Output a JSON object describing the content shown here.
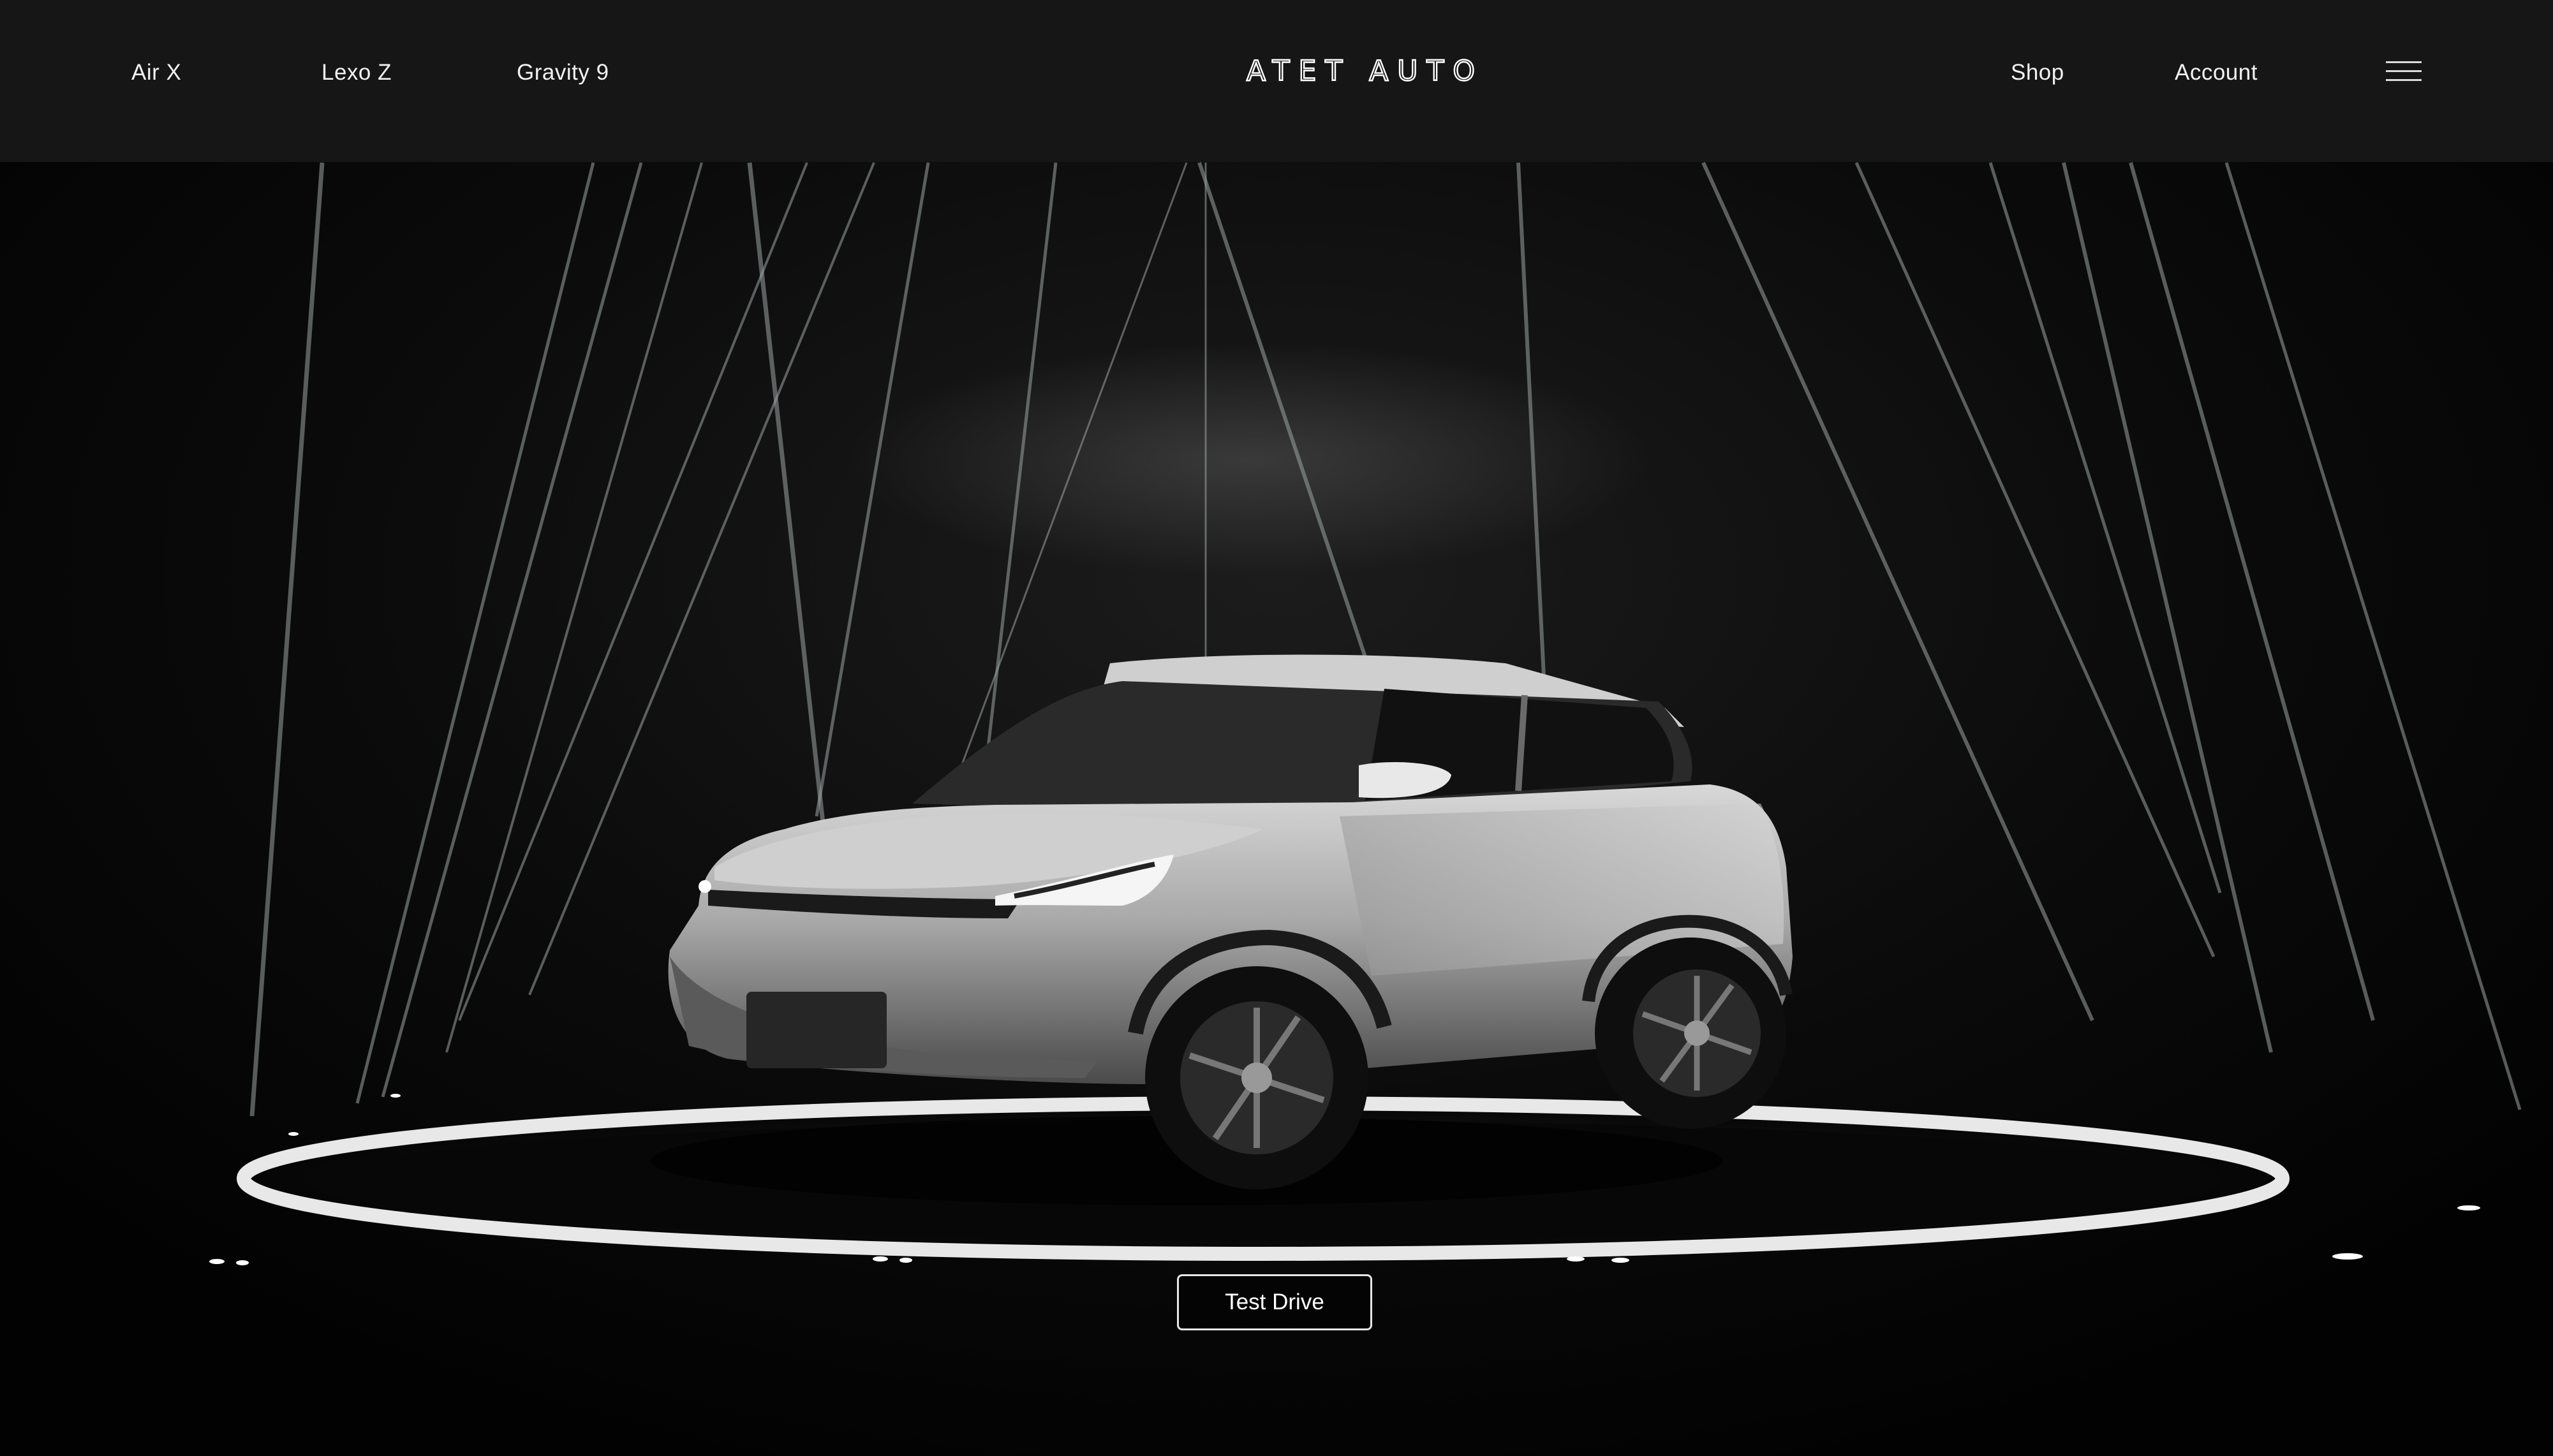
{
  "nav": {
    "left_links": [
      "Air X",
      "Lexo Z",
      "Gravity 9"
    ],
    "brand": "ATET AUTO",
    "right_links": [
      "Shop",
      "Account"
    ],
    "menu_icon": "hamburger-menu-icon"
  },
  "hero": {
    "cta_label": "Test Drive",
    "image_description_icon": "suv-car-image"
  },
  "colors": {
    "nav_background": "#161616",
    "page_background": "#050505",
    "text": "#ffffff"
  }
}
